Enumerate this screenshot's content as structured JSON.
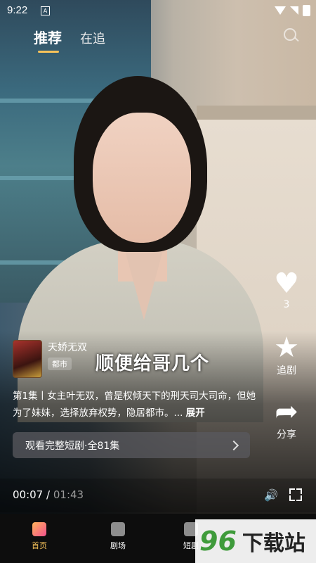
{
  "status": {
    "time": "9:22",
    "notif": "A"
  },
  "tabs": [
    {
      "label": "推荐"
    },
    {
      "label": "在追"
    }
  ],
  "side": {
    "like_count": "3",
    "follow_label": "追剧",
    "share_label": "分享"
  },
  "drama": {
    "title": "天娇无双",
    "genre": "都市",
    "poster_text": "天娇无双"
  },
  "subtitle": "顺便给哥几个",
  "description": {
    "text": "第1集丨女主叶无双，曾是权倾天下的刑天司大司命，但她为了妹妹，选择放弃权势，隐居都市。...",
    "more": "展开"
  },
  "episode_button": {
    "label": "观看完整短剧·全81集"
  },
  "player": {
    "current": "00:07",
    "sep": "/",
    "duration": "01:43"
  },
  "nav": [
    {
      "label": "首页"
    },
    {
      "label": "剧场"
    },
    {
      "label": "短剧"
    }
  ],
  "watermark": {
    "number": "96",
    "text": "下载站"
  },
  "colors": {
    "accent": "#f7c35a",
    "nav_bg": "#0d0d0d"
  }
}
